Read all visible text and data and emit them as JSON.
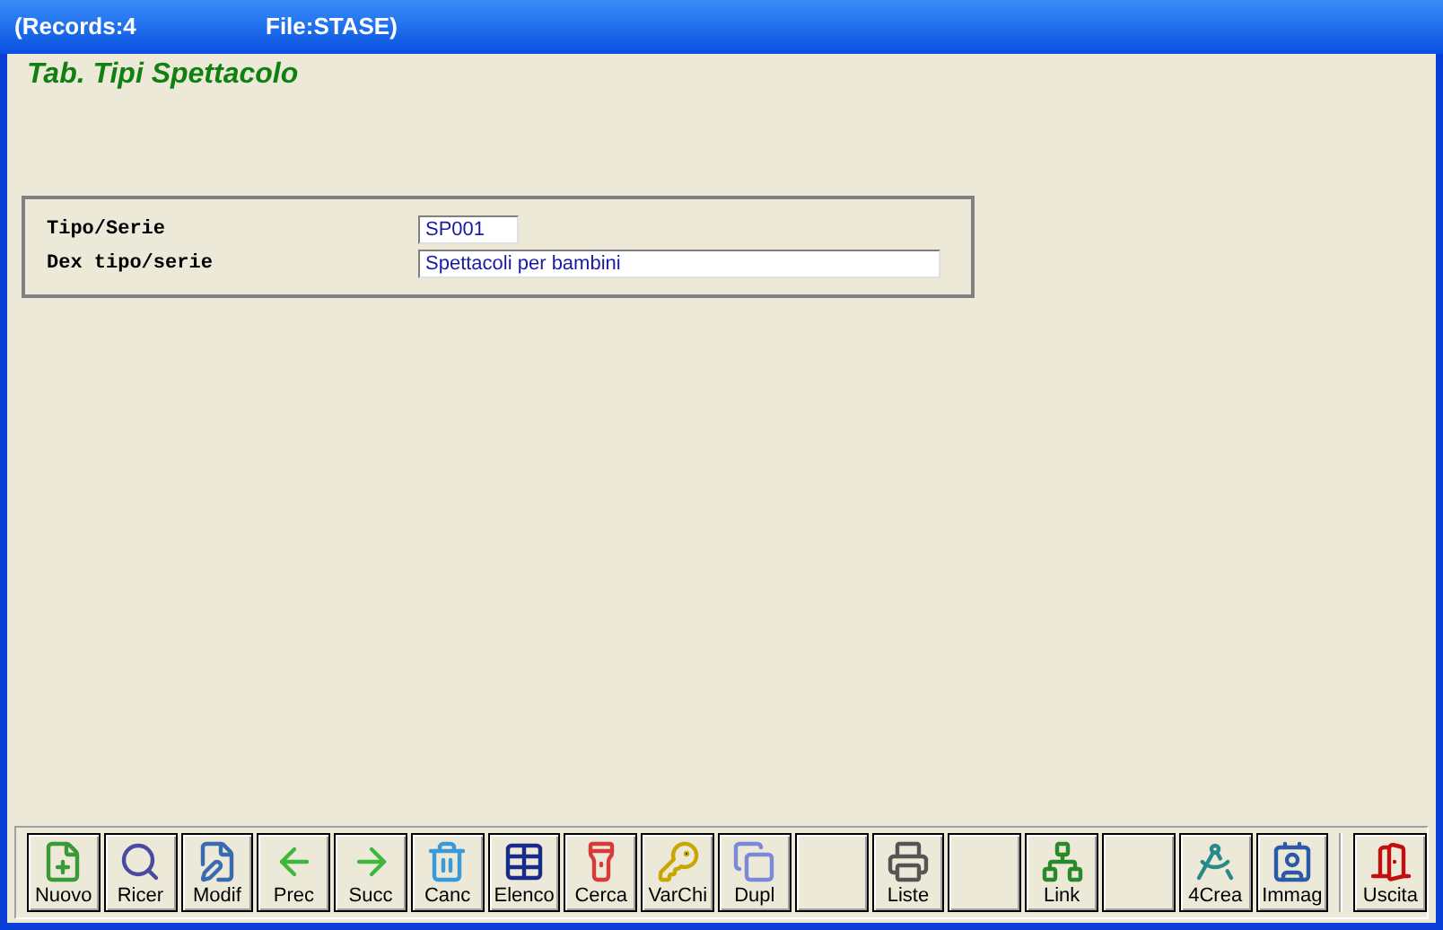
{
  "window": {
    "title_records": "(Records:4",
    "title_file": "File:STASE)"
  },
  "heading": "Tab. Tipi Spettacolo",
  "form": {
    "fields": [
      {
        "label": "Tipo/Serie",
        "value": "SP001",
        "kind": "short"
      },
      {
        "label": "Dex tipo/serie",
        "value": "Spettacoli per bambini",
        "kind": "long"
      }
    ]
  },
  "toolbar": [
    {
      "kind": "button",
      "label": "Nuovo"
    },
    {
      "kind": "button",
      "label": "Ricer"
    },
    {
      "kind": "button",
      "label": "Modif"
    },
    {
      "kind": "button",
      "label": "Prec"
    },
    {
      "kind": "button",
      "label": "Succ"
    },
    {
      "kind": "button",
      "label": "Canc"
    },
    {
      "kind": "button",
      "label": "Elenco"
    },
    {
      "kind": "button",
      "label": "Cerca"
    },
    {
      "kind": "button",
      "label": "VarChi"
    },
    {
      "kind": "button",
      "label": "Dupl"
    },
    {
      "kind": "blank"
    },
    {
      "kind": "button",
      "label": "Liste"
    },
    {
      "kind": "blank"
    },
    {
      "kind": "button",
      "label": "Link"
    },
    {
      "kind": "blank"
    },
    {
      "kind": "button",
      "label": "4Crea"
    },
    {
      "kind": "button",
      "label": "Immag"
    },
    {
      "kind": "separator"
    },
    {
      "kind": "button",
      "label": "Uscita"
    }
  ]
}
